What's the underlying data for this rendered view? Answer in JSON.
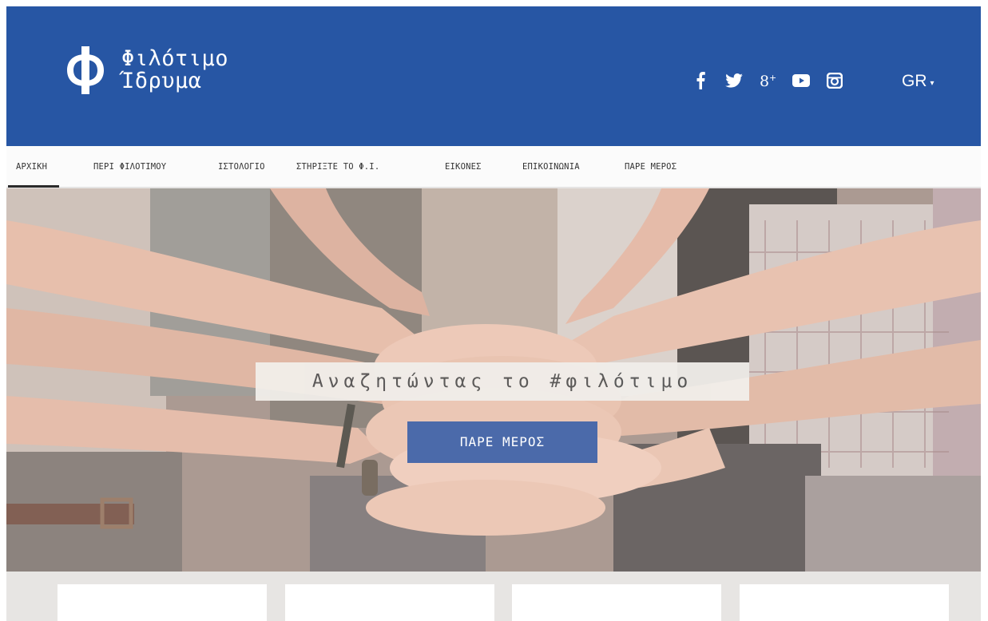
{
  "brand": {
    "line1": "Φιλότιμο",
    "line2": "Ίδρυμα",
    "logo_icon": "phi-logo-icon",
    "header_color": "#2756a4"
  },
  "socials": [
    {
      "name": "facebook-icon"
    },
    {
      "name": "twitter-icon"
    },
    {
      "name": "google-plus-icon"
    },
    {
      "name": "youtube-icon"
    },
    {
      "name": "instagram-icon"
    }
  ],
  "language": {
    "label": "GR",
    "icon": "caret-down-icon"
  },
  "nav": {
    "items": [
      {
        "label": "ΑΡΧΙΚΗ",
        "active": true
      },
      {
        "label": "ΠΕΡΙ ΦΙΛΟΤΙΜΟΥ",
        "active": false
      },
      {
        "label": "ΙΣΤΟΛΟΓΙΟ",
        "active": false
      },
      {
        "label": "ΣΤΗΡΙΞΤΕ ΤΟ Φ.Ι.",
        "active": false
      },
      {
        "label": "ΕΙΚΟΝΕΣ",
        "active": false
      },
      {
        "label": "ΕΠΙΚΟΙΝΩΝΙΑ",
        "active": false
      },
      {
        "label": "ΠΑΡΕ ΜΕΡΟΣ",
        "active": false
      }
    ]
  },
  "hero": {
    "search_text": "Αναζητώντας το #φιλότιμο",
    "cta_label": "ΠΑΡΕ ΜΕΡΟΣ",
    "cta_color": "#4b6aaa"
  }
}
